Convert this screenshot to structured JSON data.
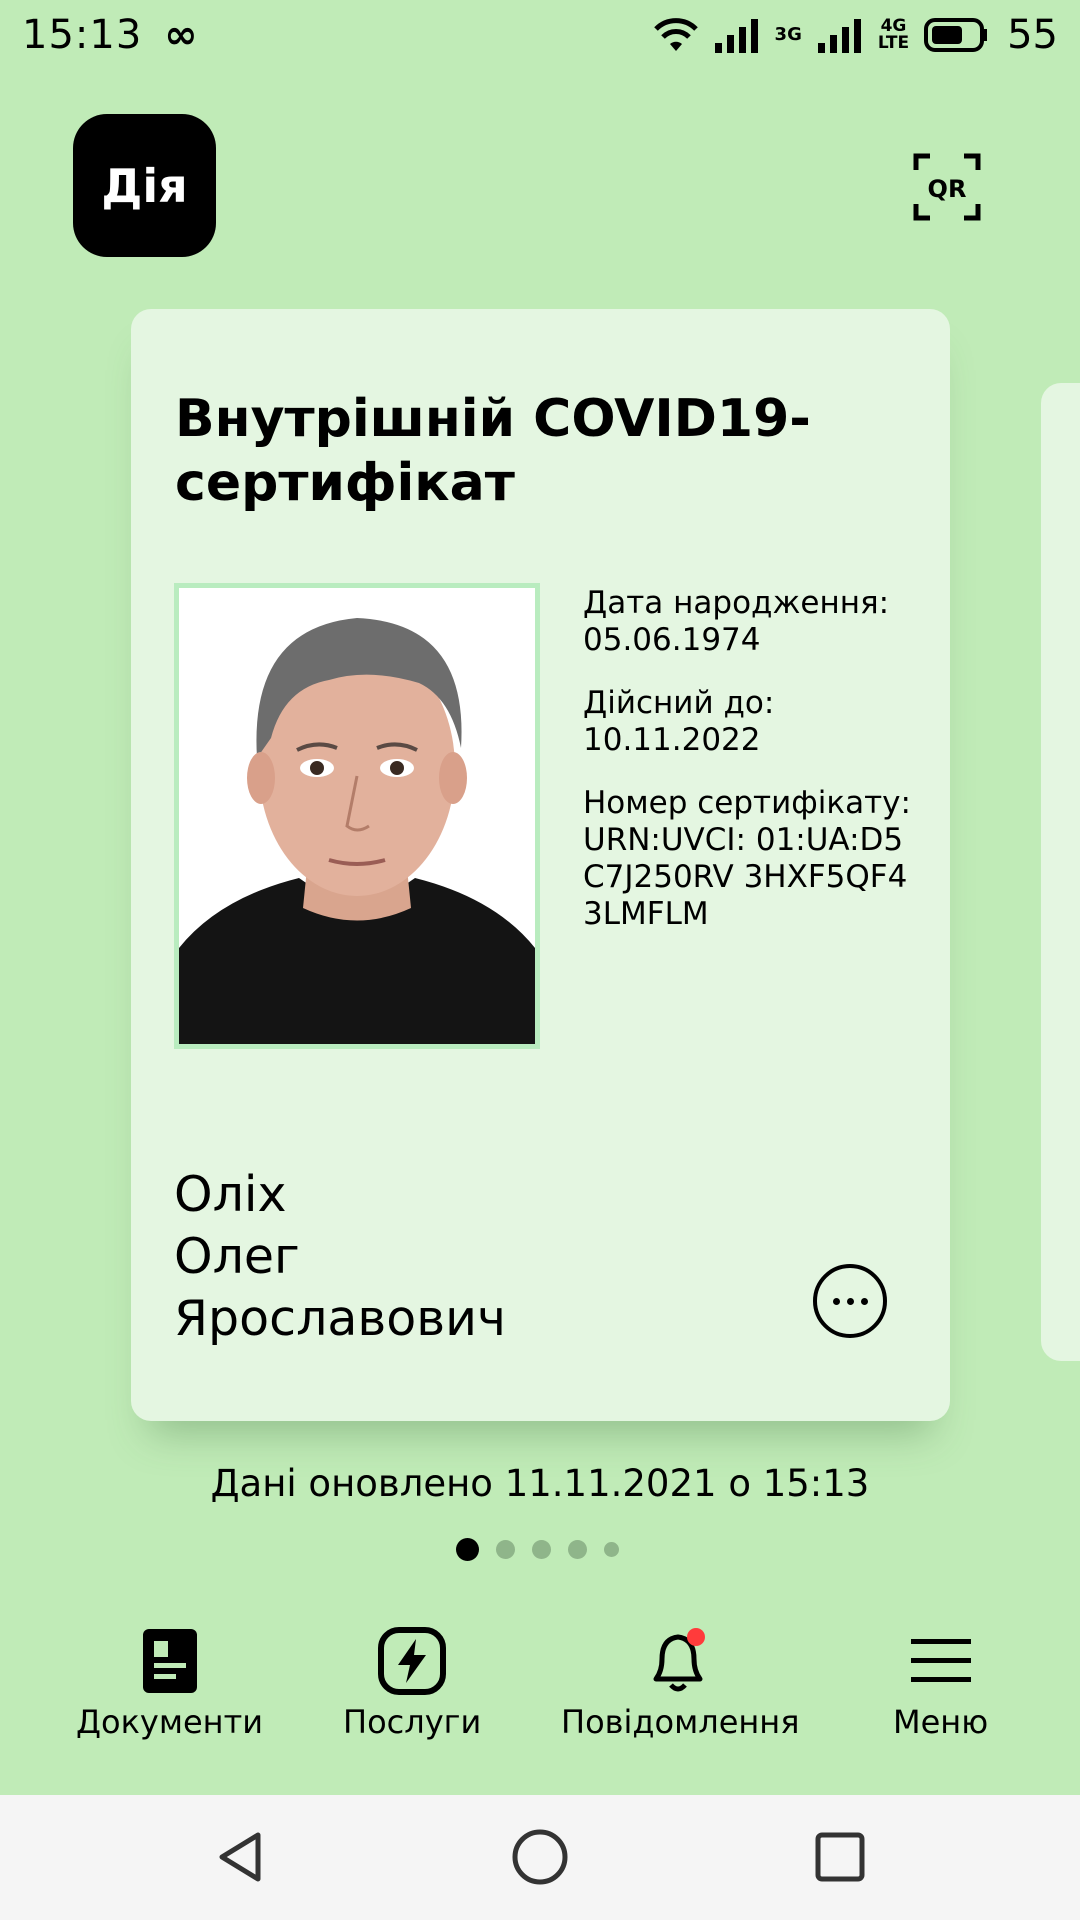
{
  "status_bar": {
    "time": "15:13",
    "link_symbol": "∞",
    "net1": "3G",
    "net2_top": "4G",
    "net2_bottom": "LTE",
    "battery": "55"
  },
  "header": {
    "logo_text": "Дія",
    "qr_label": "QR"
  },
  "card": {
    "title": "Внутрішній COVID19-сертифікат",
    "birth_label": "Дата народження:",
    "birth_value": "05.06.1974",
    "valid_label": "Дійсний до:",
    "valid_value": "10.11.2022",
    "cert_label": "Номер сертифікату:",
    "cert_value": "URN:UVCI: 01:UA:D5C7J250RV 3HXF5QF43LMFLM",
    "surname": "Оліх",
    "name": "Олег",
    "patronymic": "Ярославович"
  },
  "updated_text": "Дані оновлено 11.11.2021 о 15:13",
  "pager": {
    "count": 5,
    "active_index": 0
  },
  "bottom_nav": {
    "documents": "Документи",
    "services": "Послуги",
    "notifications": "Повідомлення",
    "menu": "Меню"
  },
  "colors": {
    "background": "#c0ebb7",
    "card": "#e4f6e1",
    "notification_dot": "#ff3b3b"
  }
}
